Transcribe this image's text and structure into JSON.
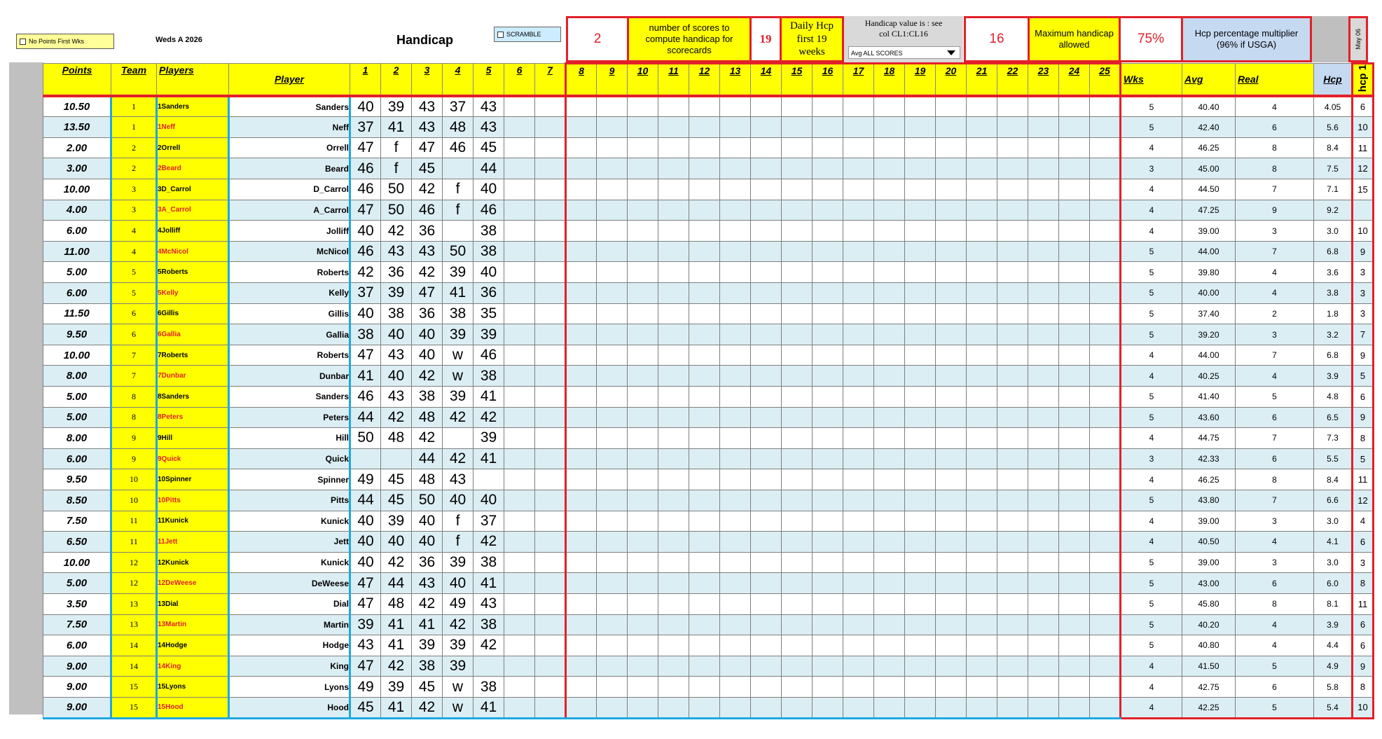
{
  "top": {
    "no_points_label": "No Points First Wks",
    "league": "Weds A 2026",
    "title": "Handicap",
    "scramble_label": "SCRAMBLE",
    "scores_count": "2",
    "scores_count_desc": "number of scores to compute handicap for scorecards",
    "daily_weeks": "19",
    "daily_desc": "Daily Hcp first 19 weeks",
    "value_desc": "Handicap value is : see col CL1:CL16",
    "dropdown_value": "Avg ALL SCORES",
    "max_hcp": "16",
    "max_hcp_desc": "Maximum handicap allowed",
    "pct": "75%",
    "pct_desc": "Hcp percentage multiplier (96% if USGA)",
    "date_label": "May 06"
  },
  "headers": {
    "points": "Points",
    "team": "Team",
    "players": "Players",
    "player": "Player",
    "weeks": [
      "1",
      "2",
      "3",
      "4",
      "5",
      "6",
      "7",
      "8",
      "9",
      "10",
      "11",
      "12",
      "13",
      "14",
      "15",
      "16",
      "17",
      "18",
      "19",
      "20",
      "21",
      "22",
      "23",
      "24",
      "25"
    ],
    "wks": "Wks",
    "avg": "Avg",
    "real": "Real",
    "hcp": "Hcp",
    "hcp1": "hcp 1"
  },
  "colors": {
    "red": "#e2202a",
    "yellow": "#ffff00",
    "blue_border": "#1fa8e0",
    "alt_row": "#dbeef3",
    "hcp_blue": "#c5d9f1"
  },
  "rows": [
    {
      "points": "10.50",
      "team": "1",
      "plist": "1Sanders",
      "red": false,
      "name": "Sanders",
      "s": [
        "40",
        "39",
        "43",
        "37",
        "43"
      ],
      "wks": "5",
      "avg": "40.40",
      "real": "4",
      "hcp": "4.05",
      "h1": "6"
    },
    {
      "points": "13.50",
      "team": "1",
      "plist": "1Neff",
      "red": true,
      "name": "Neff",
      "s": [
        "37",
        "41",
        "43",
        "48",
        "43"
      ],
      "wks": "5",
      "avg": "42.40",
      "real": "6",
      "hcp": "5.6",
      "h1": "10"
    },
    {
      "points": "2.00",
      "team": "2",
      "plist": "2Orrell",
      "red": false,
      "name": "Orrell",
      "s": [
        "47",
        "f",
        "47",
        "46",
        "45"
      ],
      "wks": "4",
      "avg": "46.25",
      "real": "8",
      "hcp": "8.4",
      "h1": "11"
    },
    {
      "points": "3.00",
      "team": "2",
      "plist": "2Beard",
      "red": true,
      "name": "Beard",
      "s": [
        "46",
        "f",
        "45",
        "",
        "44"
      ],
      "wks": "3",
      "avg": "45.00",
      "real": "8",
      "hcp": "7.5",
      "h1": "12"
    },
    {
      "points": "10.00",
      "team": "3",
      "plist": "3D_Carrol",
      "red": false,
      "name": "D_Carrol",
      "s": [
        "46",
        "50",
        "42",
        "f",
        "40"
      ],
      "wks": "4",
      "avg": "44.50",
      "real": "7",
      "hcp": "7.1",
      "h1": "15"
    },
    {
      "points": "4.00",
      "team": "3",
      "plist": "3A_Carrol",
      "red": true,
      "name": "A_Carrol",
      "s": [
        "47",
        "50",
        "46",
        "f",
        "46"
      ],
      "wks": "4",
      "avg": "47.25",
      "real": "9",
      "hcp": "9.2",
      "h1": ""
    },
    {
      "points": "6.00",
      "team": "4",
      "plist": "4Jolliff",
      "red": false,
      "name": "Jolliff",
      "s": [
        "40",
        "42",
        "36",
        "",
        "38"
      ],
      "wks": "4",
      "avg": "39.00",
      "real": "3",
      "hcp": "3.0",
      "h1": "10"
    },
    {
      "points": "11.00",
      "team": "4",
      "plist": "4McNicol",
      "red": true,
      "name": "McNicol",
      "s": [
        "46",
        "43",
        "43",
        "50",
        "38"
      ],
      "wks": "5",
      "avg": "44.00",
      "real": "7",
      "hcp": "6.8",
      "h1": "9"
    },
    {
      "points": "5.00",
      "team": "5",
      "plist": "5Roberts",
      "red": false,
      "name": "Roberts",
      "s": [
        "42",
        "36",
        "42",
        "39",
        "40"
      ],
      "wks": "5",
      "avg": "39.80",
      "real": "4",
      "hcp": "3.6",
      "h1": "3"
    },
    {
      "points": "6.00",
      "team": "5",
      "plist": "5Kelly",
      "red": true,
      "name": "Kelly",
      "s": [
        "37",
        "39",
        "47",
        "41",
        "36"
      ],
      "wks": "5",
      "avg": "40.00",
      "real": "4",
      "hcp": "3.8",
      "h1": "3"
    },
    {
      "points": "11.50",
      "team": "6",
      "plist": "6Gillis",
      "red": false,
      "name": "Gillis",
      "s": [
        "40",
        "38",
        "36",
        "38",
        "35"
      ],
      "wks": "5",
      "avg": "37.40",
      "real": "2",
      "hcp": "1.8",
      "h1": "3"
    },
    {
      "points": "9.50",
      "team": "6",
      "plist": "6Gallia",
      "red": true,
      "name": "Gallia",
      "s": [
        "38",
        "40",
        "40",
        "39",
        "39"
      ],
      "wks": "5",
      "avg": "39.20",
      "real": "3",
      "hcp": "3.2",
      "h1": "7"
    },
    {
      "points": "10.00",
      "team": "7",
      "plist": "7Roberts",
      "red": false,
      "name": "Roberts",
      "s": [
        "47",
        "43",
        "40",
        "w",
        "46"
      ],
      "wks": "4",
      "avg": "44.00",
      "real": "7",
      "hcp": "6.8",
      "h1": "9"
    },
    {
      "points": "8.00",
      "team": "7",
      "plist": "7Dunbar",
      "red": true,
      "name": "Dunbar",
      "s": [
        "41",
        "40",
        "42",
        "w",
        "38"
      ],
      "wks": "4",
      "avg": "40.25",
      "real": "4",
      "hcp": "3.9",
      "h1": "5"
    },
    {
      "points": "5.00",
      "team": "8",
      "plist": "8Sanders",
      "red": false,
      "name": "Sanders",
      "s": [
        "46",
        "43",
        "38",
        "39",
        "41"
      ],
      "wks": "5",
      "avg": "41.40",
      "real": "5",
      "hcp": "4.8",
      "h1": "6"
    },
    {
      "points": "5.00",
      "team": "8",
      "plist": "8Peters",
      "red": true,
      "name": "Peters",
      "s": [
        "44",
        "42",
        "48",
        "42",
        "42"
      ],
      "wks": "5",
      "avg": "43.60",
      "real": "6",
      "hcp": "6.5",
      "h1": "9"
    },
    {
      "points": "8.00",
      "team": "9",
      "plist": "9Hill",
      "red": false,
      "name": "Hill",
      "s": [
        "50",
        "48",
        "42",
        "",
        "39"
      ],
      "wks": "4",
      "avg": "44.75",
      "real": "7",
      "hcp": "7.3",
      "h1": "8"
    },
    {
      "points": "6.00",
      "team": "9",
      "plist": "9Quick",
      "red": true,
      "name": "Quick",
      "s": [
        "",
        "",
        "44",
        "42",
        "41"
      ],
      "wks": "3",
      "avg": "42.33",
      "real": "6",
      "hcp": "5.5",
      "h1": "5"
    },
    {
      "points": "9.50",
      "team": "10",
      "plist": "10Spinner",
      "red": false,
      "name": "Spinner",
      "s": [
        "49",
        "45",
        "48",
        "43",
        ""
      ],
      "wks": "4",
      "avg": "46.25",
      "real": "8",
      "hcp": "8.4",
      "h1": "11"
    },
    {
      "points": "8.50",
      "team": "10",
      "plist": "10Pitts",
      "red": true,
      "name": "Pitts",
      "s": [
        "44",
        "45",
        "50",
        "40",
        "40"
      ],
      "wks": "5",
      "avg": "43.80",
      "real": "7",
      "hcp": "6.6",
      "h1": "12"
    },
    {
      "points": "7.50",
      "team": "11",
      "plist": "11Kunick",
      "red": false,
      "name": "Kunick",
      "s": [
        "40",
        "39",
        "40",
        "f",
        "37"
      ],
      "wks": "4",
      "avg": "39.00",
      "real": "3",
      "hcp": "3.0",
      "h1": "4"
    },
    {
      "points": "6.50",
      "team": "11",
      "plist": "11Jett",
      "red": true,
      "name": "Jett",
      "s": [
        "40",
        "40",
        "40",
        "f",
        "42"
      ],
      "wks": "4",
      "avg": "40.50",
      "real": "4",
      "hcp": "4.1",
      "h1": "6"
    },
    {
      "points": "10.00",
      "team": "12",
      "plist": "12Kunick",
      "red": false,
      "name": "Kunick",
      "s": [
        "40",
        "42",
        "36",
        "39",
        "38"
      ],
      "wks": "5",
      "avg": "39.00",
      "real": "3",
      "hcp": "3.0",
      "h1": "3"
    },
    {
      "points": "5.00",
      "team": "12",
      "plist": "12DeWeese",
      "red": true,
      "name": "DeWeese",
      "s": [
        "47",
        "44",
        "43",
        "40",
        "41"
      ],
      "wks": "5",
      "avg": "43.00",
      "real": "6",
      "hcp": "6.0",
      "h1": "8"
    },
    {
      "points": "3.50",
      "team": "13",
      "plist": "13Dial",
      "red": false,
      "name": "Dial",
      "s": [
        "47",
        "48",
        "42",
        "49",
        "43"
      ],
      "wks": "5",
      "avg": "45.80",
      "real": "8",
      "hcp": "8.1",
      "h1": "11"
    },
    {
      "points": "7.50",
      "team": "13",
      "plist": "13Martin",
      "red": true,
      "name": "Martin",
      "s": [
        "39",
        "41",
        "41",
        "42",
        "38"
      ],
      "wks": "5",
      "avg": "40.20",
      "real": "4",
      "hcp": "3.9",
      "h1": "6"
    },
    {
      "points": "6.00",
      "team": "14",
      "plist": "14Hodge",
      "red": false,
      "name": "Hodge",
      "s": [
        "43",
        "41",
        "39",
        "39",
        "42"
      ],
      "wks": "5",
      "avg": "40.80",
      "real": "4",
      "hcp": "4.4",
      "h1": "6"
    },
    {
      "points": "9.00",
      "team": "14",
      "plist": "14King",
      "red": true,
      "name": "King",
      "s": [
        "47",
        "42",
        "38",
        "39",
        ""
      ],
      "wks": "4",
      "avg": "41.50",
      "real": "5",
      "hcp": "4.9",
      "h1": "9"
    },
    {
      "points": "9.00",
      "team": "15",
      "plist": "15Lyons",
      "red": false,
      "name": "Lyons",
      "s": [
        "49",
        "39",
        "45",
        "w",
        "38"
      ],
      "wks": "4",
      "avg": "42.75",
      "real": "6",
      "hcp": "5.8",
      "h1": "8"
    },
    {
      "points": "9.00",
      "team": "15",
      "plist": "15Hood",
      "red": true,
      "name": "Hood",
      "s": [
        "45",
        "41",
        "42",
        "w",
        "41"
      ],
      "wks": "4",
      "avg": "42.25",
      "real": "5",
      "hcp": "5.4",
      "h1": "10"
    }
  ]
}
